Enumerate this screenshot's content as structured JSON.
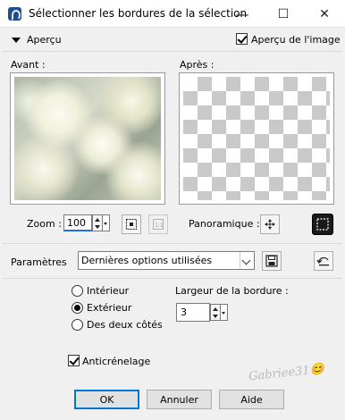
{
  "window": {
    "title": "Sélectionner les bordures de la sélection",
    "controls": {
      "minimize": "—",
      "maximize": "☐",
      "close": "✕"
    }
  },
  "apercu": {
    "label": "Aperçu",
    "apercu_image_label": "Aperçu de l'image",
    "apercu_image_checked": true
  },
  "preview": {
    "avant_label": "Avant :",
    "apres_label": "Après :"
  },
  "zoom": {
    "label": "Zoom :",
    "value": "100"
  },
  "panoramique": {
    "label": "Panoramique :"
  },
  "parametres": {
    "label": "Paramètres",
    "selected": "Dernières options utilisées"
  },
  "options": {
    "radios": [
      {
        "label": "Intérieur",
        "selected": false
      },
      {
        "label": "Extérieur",
        "selected": true
      },
      {
        "label": "Des deux côtés",
        "selected": false
      }
    ],
    "largeur_label": "Largeur de la bordure :",
    "largeur_value": "3",
    "anticrenelage_label": "Anticrénelage",
    "anticrenelage_checked": true
  },
  "buttons": {
    "ok": "OK",
    "cancel": "Annuler",
    "help": "Aide"
  },
  "signature": "Gabriee31😊"
}
